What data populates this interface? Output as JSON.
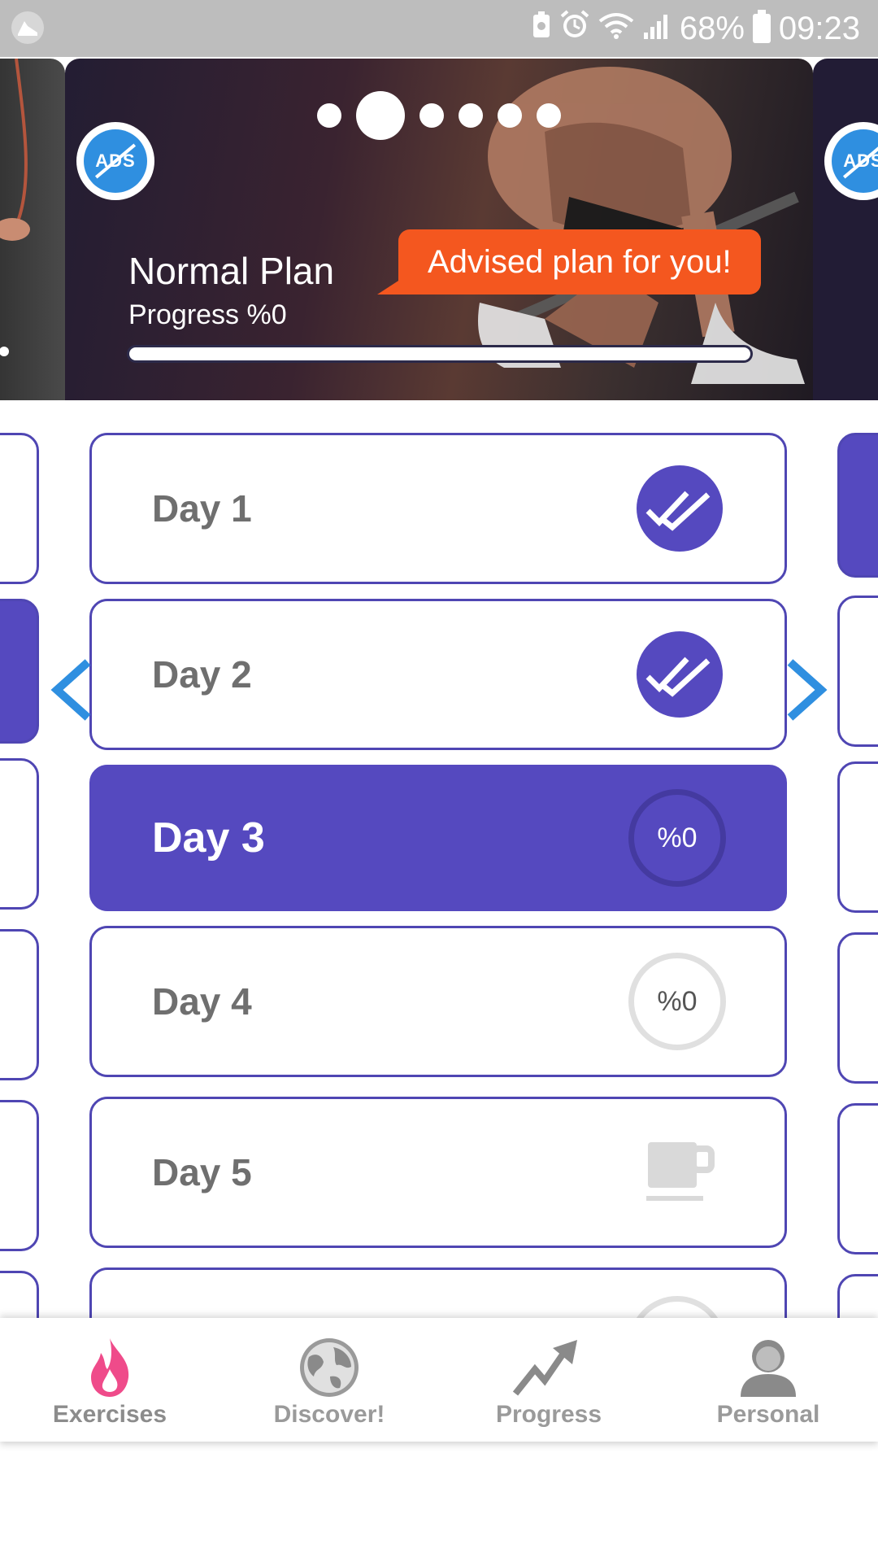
{
  "status_bar": {
    "battery": "68%",
    "time": "09:23"
  },
  "hero": {
    "plan_title": "Normal Plan",
    "progress_text": "Progress %0",
    "progress_fraction": 0,
    "advice_text": "Advised plan for you!",
    "ads_label": "ADS",
    "page_count": 6,
    "active_page": 1
  },
  "days": [
    {
      "label": "Day 1",
      "status": "done"
    },
    {
      "label": "Day 2",
      "status": "done"
    },
    {
      "label": "Day 3",
      "status": "active",
      "percent": "%0"
    },
    {
      "label": "Day 4",
      "status": "pending",
      "percent": "%0"
    },
    {
      "label": "Day 5",
      "status": "rest"
    }
  ],
  "bottom_nav": {
    "items": [
      {
        "label": "Exercises",
        "icon": "flame-icon",
        "active": true
      },
      {
        "label": "Discover!",
        "icon": "globe-icon",
        "active": false
      },
      {
        "label": "Progress",
        "icon": "trend-arrow-icon",
        "active": false
      },
      {
        "label": "Personal",
        "icon": "person-icon",
        "active": false
      }
    ]
  },
  "colors": {
    "accent": "#5549bf",
    "advice": "#f4571f",
    "active_nav": "#ef4b8a",
    "arrow": "#2f8fe0"
  }
}
